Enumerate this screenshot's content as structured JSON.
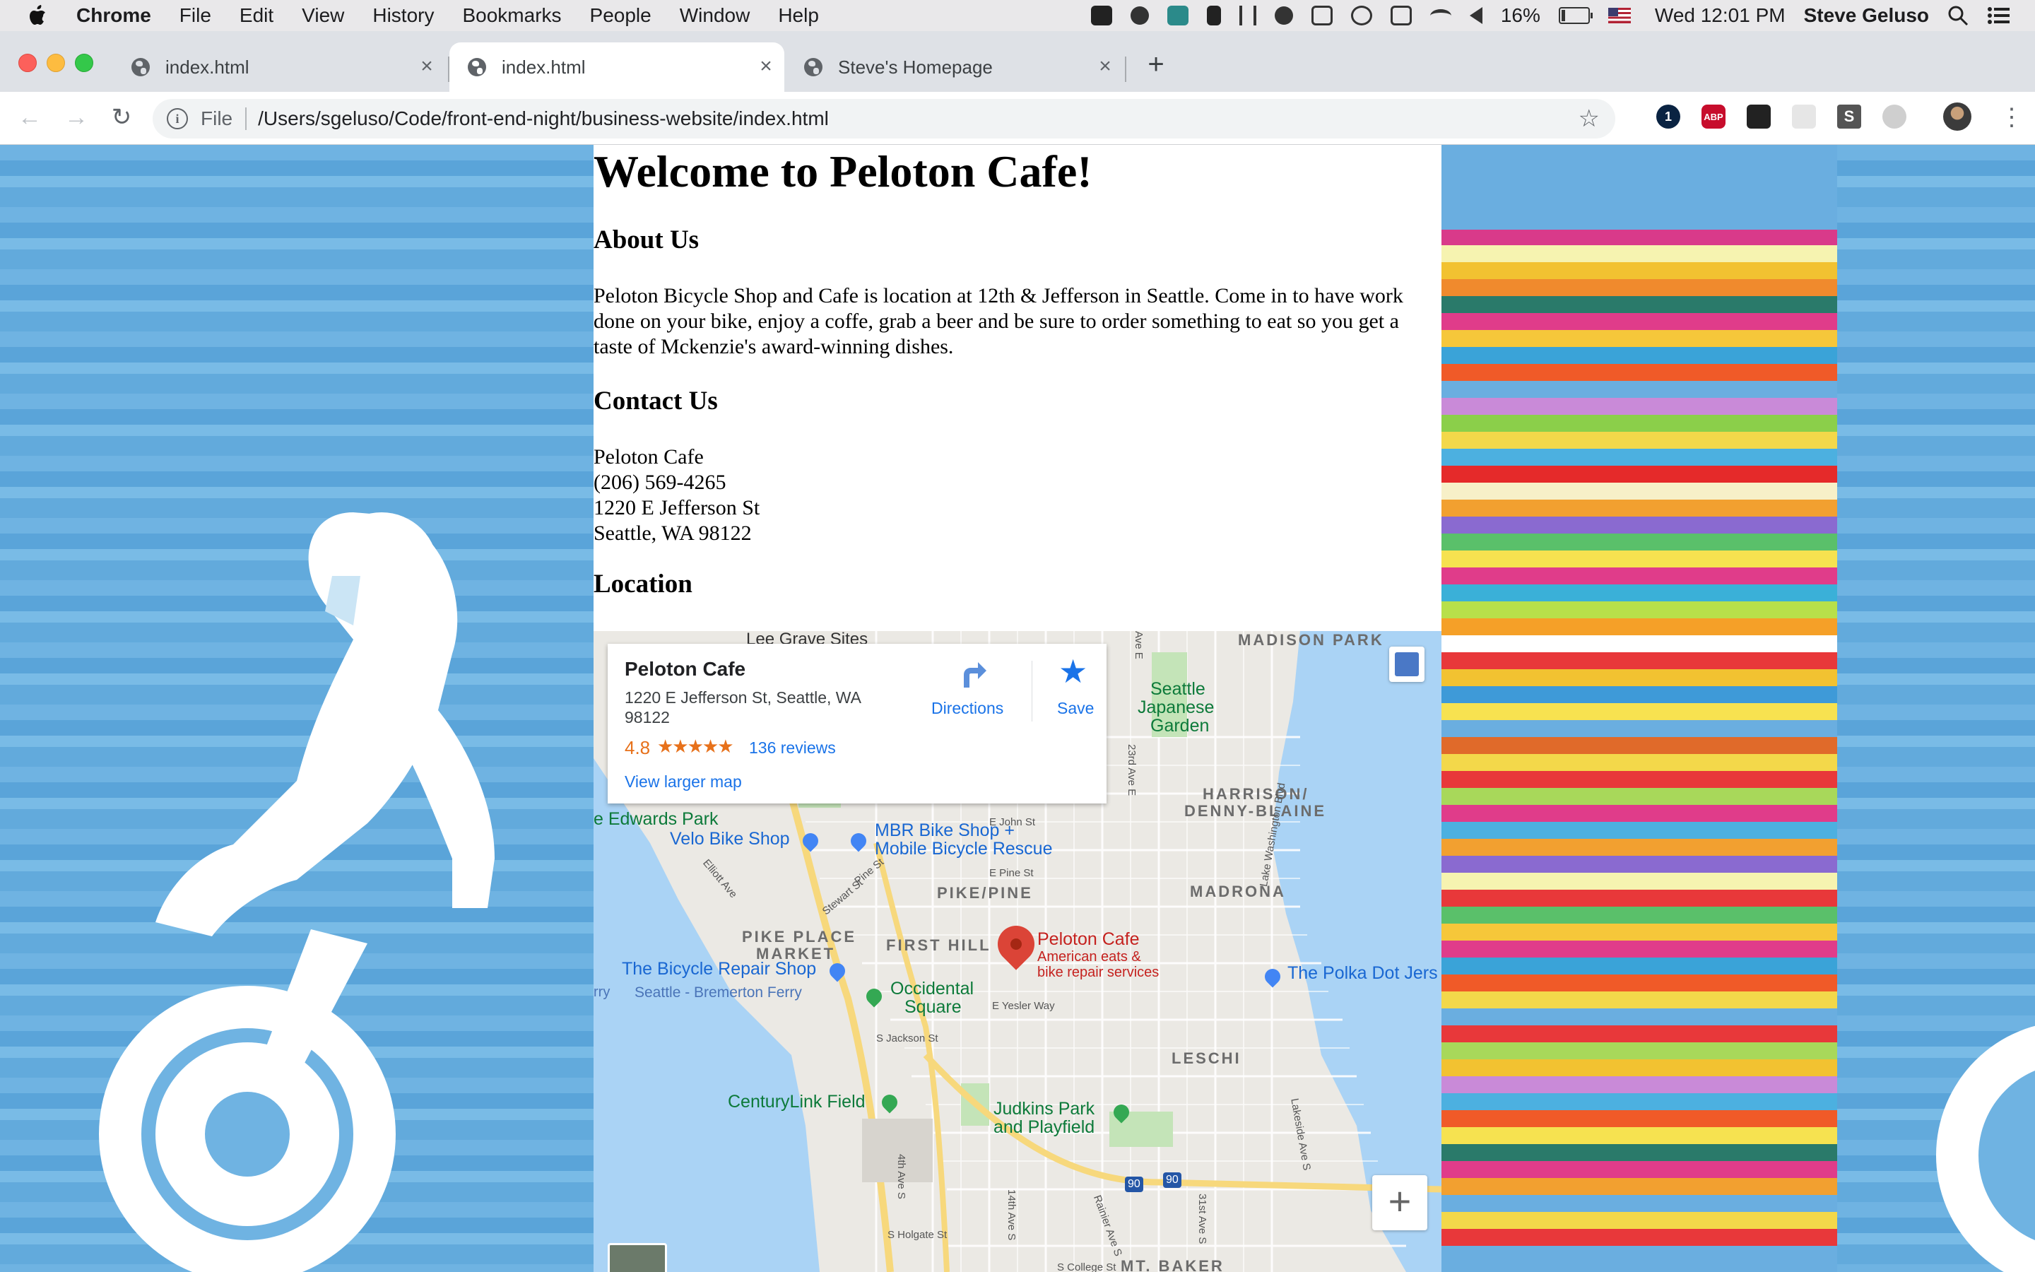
{
  "menubar": {
    "app": "Chrome",
    "items": [
      "File",
      "Edit",
      "View",
      "History",
      "Bookmarks",
      "People",
      "Window",
      "Help"
    ],
    "battery": "16%",
    "clock": "Wed 12:01 PM",
    "user": "Steve Geluso"
  },
  "tabs": [
    {
      "title": "index.html",
      "active": false
    },
    {
      "title": "index.html",
      "active": true
    },
    {
      "title": "Steve's Homepage",
      "active": false
    }
  ],
  "toolbar": {
    "scheme": "File",
    "url": "/Users/sgeluso/Code/front-end-night/business-website/index.html",
    "extensions": [
      "1password-icon",
      "adblock-plus-icon",
      "extension-icon",
      "grid-extension-icon",
      "s-extension-icon",
      "circle-extension-icon",
      "profile-avatar-icon"
    ]
  },
  "page": {
    "title": "Welcome to Peloton Cafe!",
    "about_heading": "About Us",
    "about_text": "Peloton Bicycle Shop and Cafe is location at 12th & Jefferson in Seattle. Come in to have work done on your bike, enjoy a coffe, grab a beer and be sure to order something to eat so you get a taste of Mckenzie's award-winning dishes.",
    "contact_heading": "Contact Us",
    "contact_lines": [
      "Peloton Cafe",
      "(206) 569-4265",
      "1220 E Jefferson St",
      "Seattle, WA 98122"
    ],
    "location_heading": "Location"
  },
  "map": {
    "card": {
      "name": "Peloton Cafe",
      "address": "1220 E Jefferson St, Seattle, WA 98122",
      "rating": "4.8",
      "stars": "★★★★★",
      "reviews": "136 reviews",
      "larger_map": "View larger map",
      "directions": "Directions",
      "save": "Save"
    },
    "zoom_in": "+",
    "labels": {
      "lee_grave": "Lee Grave Sites",
      "madison_park": "MADISON PARK",
      "japanese_garden_1": "Seattle",
      "japanese_garden_2": "Japanese",
      "japanese_garden_3": "Garden",
      "harrison_1": "HARRISON/",
      "harrison_2": "DENNY-BLAINE",
      "edwards_park": "e Edwards Park",
      "velo": "Velo Bike Shop",
      "mbr_1": "MBR Bike Shop +",
      "mbr_2": "Mobile Bicycle Rescue",
      "pike_pine": "PIKE/PINE",
      "madrona": "MADRONA",
      "pike_place_1": "PIKE PLACE",
      "pike_place_2": "MARKET",
      "first_hill": "FIRST HILL",
      "peloton": "Peloton Cafe",
      "peloton_sub_1": "American eats &",
      "peloton_sub_2": "bike repair services",
      "bicycle_repair": "The Bicycle Repair Shop",
      "rry": "rry",
      "ferry": "Seattle - Bremerton Ferry",
      "occidental_1": "Occidental",
      "occidental_2": "Square",
      "polka": "The Polka Dot Jers",
      "leschi": "LESCHI",
      "centurylink": "CenturyLink Field",
      "judkins_1": "Judkins Park",
      "judkins_2": "and Playfield",
      "mt_baker": "MT. BAKER",
      "e_john": "E John St",
      "e_pine": "E Pine St",
      "e_yesler": "E Yesler Way",
      "s_jackson": "S Jackson St",
      "s_holgate": "S Holgate St",
      "s_college": "S College St",
      "elliott": "Elliott Ave",
      "stewart": "Stewart St",
      "pine_st": "Pine St",
      "ave23": "23rd Ave E",
      "lake_wash": "Lake Washington Blvd",
      "lakeside": "Lakeside Ave S",
      "ave31": "31st Ave S",
      "ave14": "14th Ave S",
      "rainier": "Rainier Ave S",
      "ave4": "4th Ave S",
      "ave_e": "Ave E",
      "i90_a": "90",
      "i90_b": "90",
      "i90_c": "90"
    }
  },
  "colors": {
    "accent": "#1a73e8",
    "rating": "#e7711b",
    "pin": "#db4437"
  }
}
